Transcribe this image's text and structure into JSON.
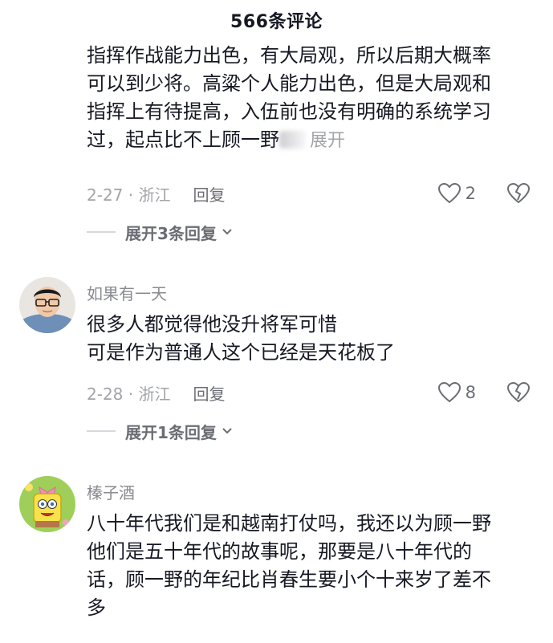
{
  "header": {
    "title": "566条评论"
  },
  "comments": [
    {
      "username": "",
      "lines": [
        "指挥作战能力出色，有大局观，所以后期大概率",
        "可以到少将。高粱个人能力出色，但是大局观和",
        "指挥上有待提高，入伍前也没有明确的系统学习",
        "过，起点比不上顾一野"
      ],
      "truncated_label": "展开",
      "date_location": "2-27 · 浙江",
      "reply_label": "回复",
      "likes": "2",
      "expand_replies_label": "展开3条回复"
    },
    {
      "username": "如果有一天",
      "lines": [
        "很多人都觉得他没升将军可惜",
        "可是作为普通人这个已经是天花板了"
      ],
      "date_location": "2-28 · 浙江",
      "reply_label": "回复",
      "likes": "8",
      "expand_replies_label": "展开1条回复"
    },
    {
      "username": "榛子酒",
      "lines": [
        "八十年代我们是和越南打仗吗，我还以为顾一野",
        "他们是五十年代的故事呢，那要是八十年代的",
        "话，顾一野的年纪比肖春生要小个十来岁了差不",
        "多"
      ]
    }
  ],
  "colors": {
    "text": "#161823",
    "meta": "#a3a4a8",
    "secondary": "#6b6d74",
    "background": "#ffffff"
  },
  "icons": [
    "heart-outline-icon",
    "broken-heart-icon",
    "chevron-down-icon"
  ]
}
